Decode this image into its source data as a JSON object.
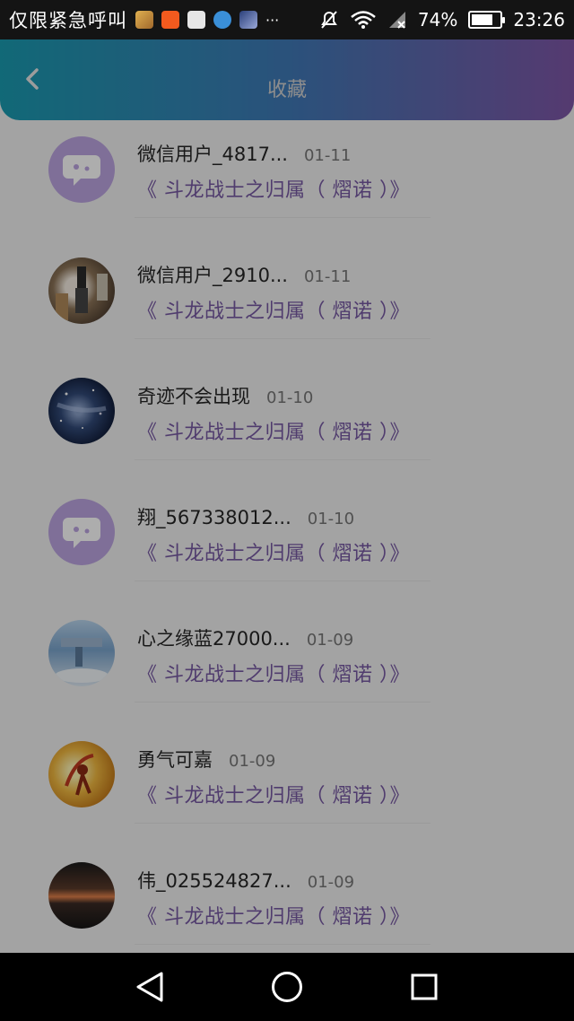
{
  "status_bar": {
    "carrier": "仅限紧急呼叫",
    "more": "···",
    "battery_percent": "74%",
    "battery_level": 0.74,
    "time": "23:26"
  },
  "header": {
    "title": "收藏",
    "back_icon": "chevron-left-icon"
  },
  "accent_colors": {
    "header_gradient": [
      "#1a9bb0",
      "#3f79b6",
      "#7e56a6"
    ],
    "book_title": "#7759a3",
    "placeholder_avatar": "#bba4e0"
  },
  "favorites": [
    {
      "name": "微信用户_4817...",
      "date": "01-11",
      "book": "《 斗龙战士之归属（ 熠诺 ）》",
      "avatar": "placeholder-chat-avatar"
    },
    {
      "name": "微信用户_2910...",
      "date": "01-11",
      "book": "《 斗龙战士之归属（ 熠诺 ）》",
      "avatar": "room-photo-avatar"
    },
    {
      "name": "奇迹不会出现",
      "date": "01-10",
      "book": "《 斗龙战士之归属（ 熠诺 ）》",
      "avatar": "night-sky-avatar"
    },
    {
      "name": "翔_567338012...",
      "date": "01-10",
      "book": "《 斗龙战士之归属（ 熠诺 ）》",
      "avatar": "placeholder-chat-avatar"
    },
    {
      "name": "心之缘蓝27000...",
      "date": "01-09",
      "book": "《 斗龙战士之归属（ 熠诺 ）》",
      "avatar": "sky-city-avatar"
    },
    {
      "name": "勇气可嘉",
      "date": "01-09",
      "book": "《 斗龙战士之归属（ 熠诺 ）》",
      "avatar": "golden-warrior-avatar"
    },
    {
      "name": "伟_025524827...",
      "date": "01-09",
      "book": "《 斗龙战士之归属（ 熠诺 ）》",
      "avatar": "sunset-avatar"
    }
  ],
  "nav_bar": {
    "back_icon": "triangle-back-icon",
    "home_icon": "circle-home-icon",
    "recents_icon": "square-recents-icon"
  }
}
